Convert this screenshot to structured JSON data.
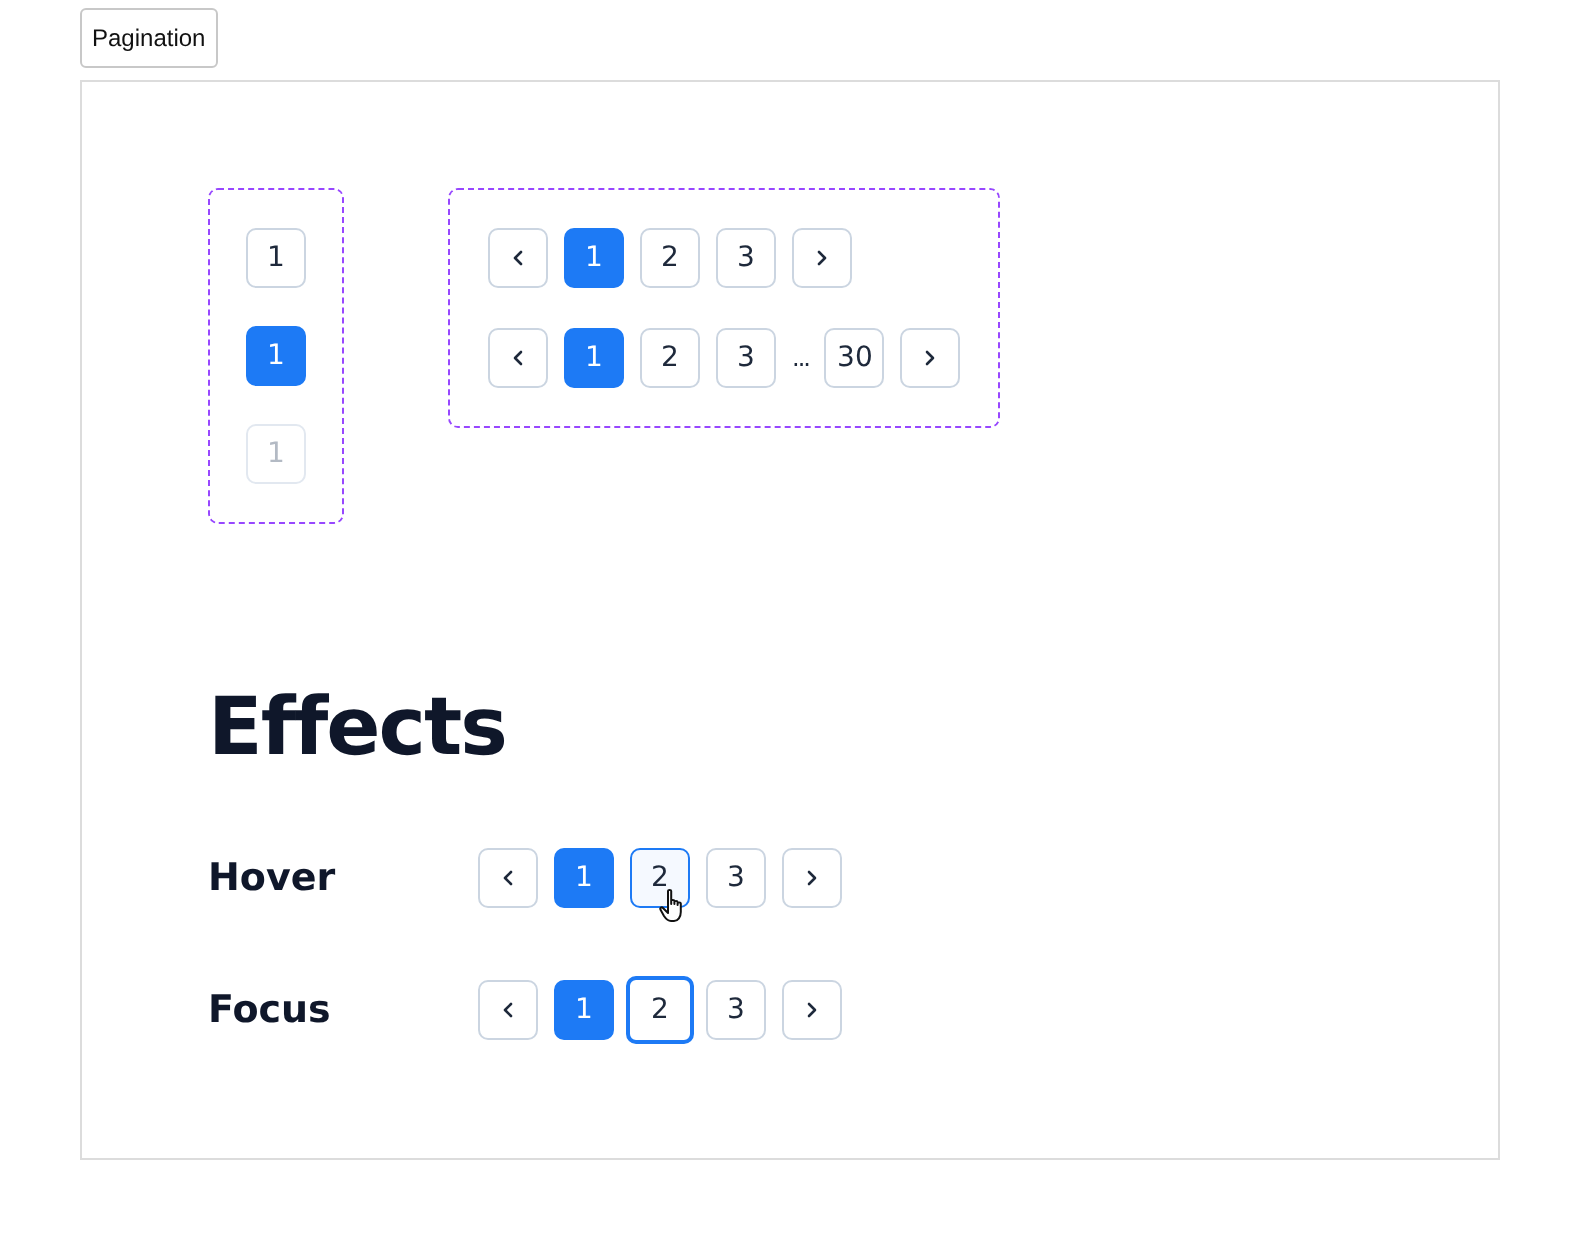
{
  "tab": {
    "label": "Pagination"
  },
  "states": [
    {
      "label": "1",
      "selected": false,
      "disabled": false
    },
    {
      "label": "1",
      "selected": true,
      "disabled": false
    },
    {
      "label": "1",
      "selected": false,
      "disabled": true
    }
  ],
  "paginations": [
    {
      "items": [
        {
          "kind": "prev"
        },
        {
          "kind": "page",
          "label": "1",
          "selected": true
        },
        {
          "kind": "page",
          "label": "2",
          "selected": false
        },
        {
          "kind": "page",
          "label": "3",
          "selected": false
        },
        {
          "kind": "next"
        }
      ]
    },
    {
      "items": [
        {
          "kind": "prev"
        },
        {
          "kind": "page",
          "label": "1",
          "selected": true
        },
        {
          "kind": "page",
          "label": "2",
          "selected": false
        },
        {
          "kind": "page",
          "label": "3",
          "selected": false
        },
        {
          "kind": "ellipsis",
          "label": "..."
        },
        {
          "kind": "page",
          "label": "30",
          "selected": false
        },
        {
          "kind": "next"
        }
      ]
    }
  ],
  "effects": {
    "title": "Effects",
    "rows": [
      {
        "label": "Hover",
        "items": [
          {
            "kind": "prev"
          },
          {
            "kind": "page",
            "label": "1",
            "selected": true,
            "hovered": false
          },
          {
            "kind": "page",
            "label": "2",
            "selected": false,
            "hovered": true
          },
          {
            "kind": "page",
            "label": "3",
            "selected": false,
            "hovered": false
          },
          {
            "kind": "next"
          }
        ]
      },
      {
        "label": "Focus",
        "items": [
          {
            "kind": "prev"
          },
          {
            "kind": "page",
            "label": "1",
            "selected": true,
            "focused": false
          },
          {
            "kind": "page",
            "label": "2",
            "selected": false,
            "focused": true
          },
          {
            "kind": "page",
            "label": "3",
            "selected": false,
            "focused": false
          },
          {
            "kind": "next"
          }
        ]
      }
    ]
  }
}
